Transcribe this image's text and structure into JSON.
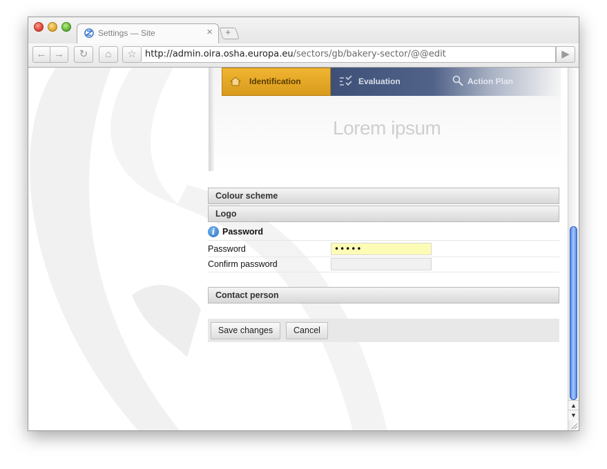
{
  "browser": {
    "tab_title": "Settings — Site",
    "tab_close": "×",
    "new_tab": "+",
    "url_host": "http://admin.oira.osha.europa.eu",
    "url_path": "/sectors/gb/bakery-sector/@@edit",
    "buttons": {
      "back": "←",
      "forward": "→",
      "reload": "↻",
      "home": "⌂",
      "bookmark": "☆",
      "go": "▶"
    }
  },
  "app": {
    "nav": {
      "identification": "Identification",
      "evaluation": "Evaluation",
      "action_plan": "Action Plan",
      "active": "identification"
    },
    "hero_text": "Lorem ipsum"
  },
  "form": {
    "sections": {
      "colour_scheme": "Colour scheme",
      "logo": "Logo",
      "contact_person": "Contact person"
    },
    "password_group": {
      "title": "Password",
      "info_glyph": "i",
      "password_label": "Password",
      "password_value": "•••••",
      "confirm_label": "Confirm password",
      "confirm_value": ""
    },
    "actions": {
      "save": "Save changes",
      "cancel": "Cancel"
    }
  },
  "scrollbar": {
    "up": "▲",
    "down": "▼"
  },
  "colors": {
    "nav_active": "#e3a526",
    "nav_inactive": "#46587f",
    "password_fill": "#fdfcb6",
    "scroll_thumb": "#4f86e6"
  }
}
